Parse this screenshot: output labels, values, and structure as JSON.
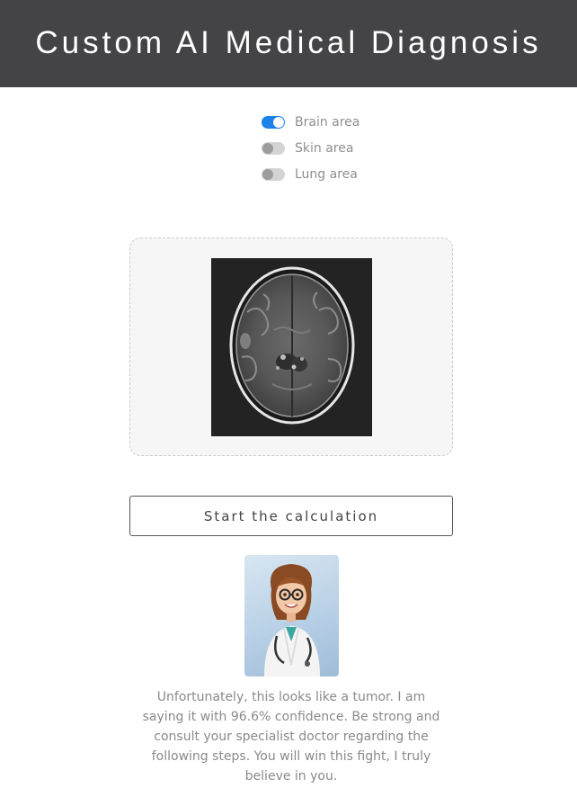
{
  "header": {
    "title": "Custom AI Medical Diagnosis"
  },
  "areas": [
    {
      "label": "Brain area",
      "checked": true
    },
    {
      "label": "Skin area",
      "checked": false
    },
    {
      "label": "Lung area",
      "checked": false
    }
  ],
  "upload": {
    "image_semantic": "brain-mri-scan"
  },
  "actions": {
    "calculate_label": "Start the calculation"
  },
  "doctor": {
    "image_semantic": "doctor-avatar"
  },
  "result": {
    "text": "Unfortunately, this looks like a tumor. I am saying it with 96.6% confidence. Be strong and consult your specialist doctor regarding the following steps. You will win this fight, I truly believe in you."
  },
  "colors": {
    "header_bg": "#444446",
    "toggle_on": "#1a82e8",
    "toggle_off": "#d4d4d4",
    "dropzone_bg": "#f6f6f6"
  }
}
